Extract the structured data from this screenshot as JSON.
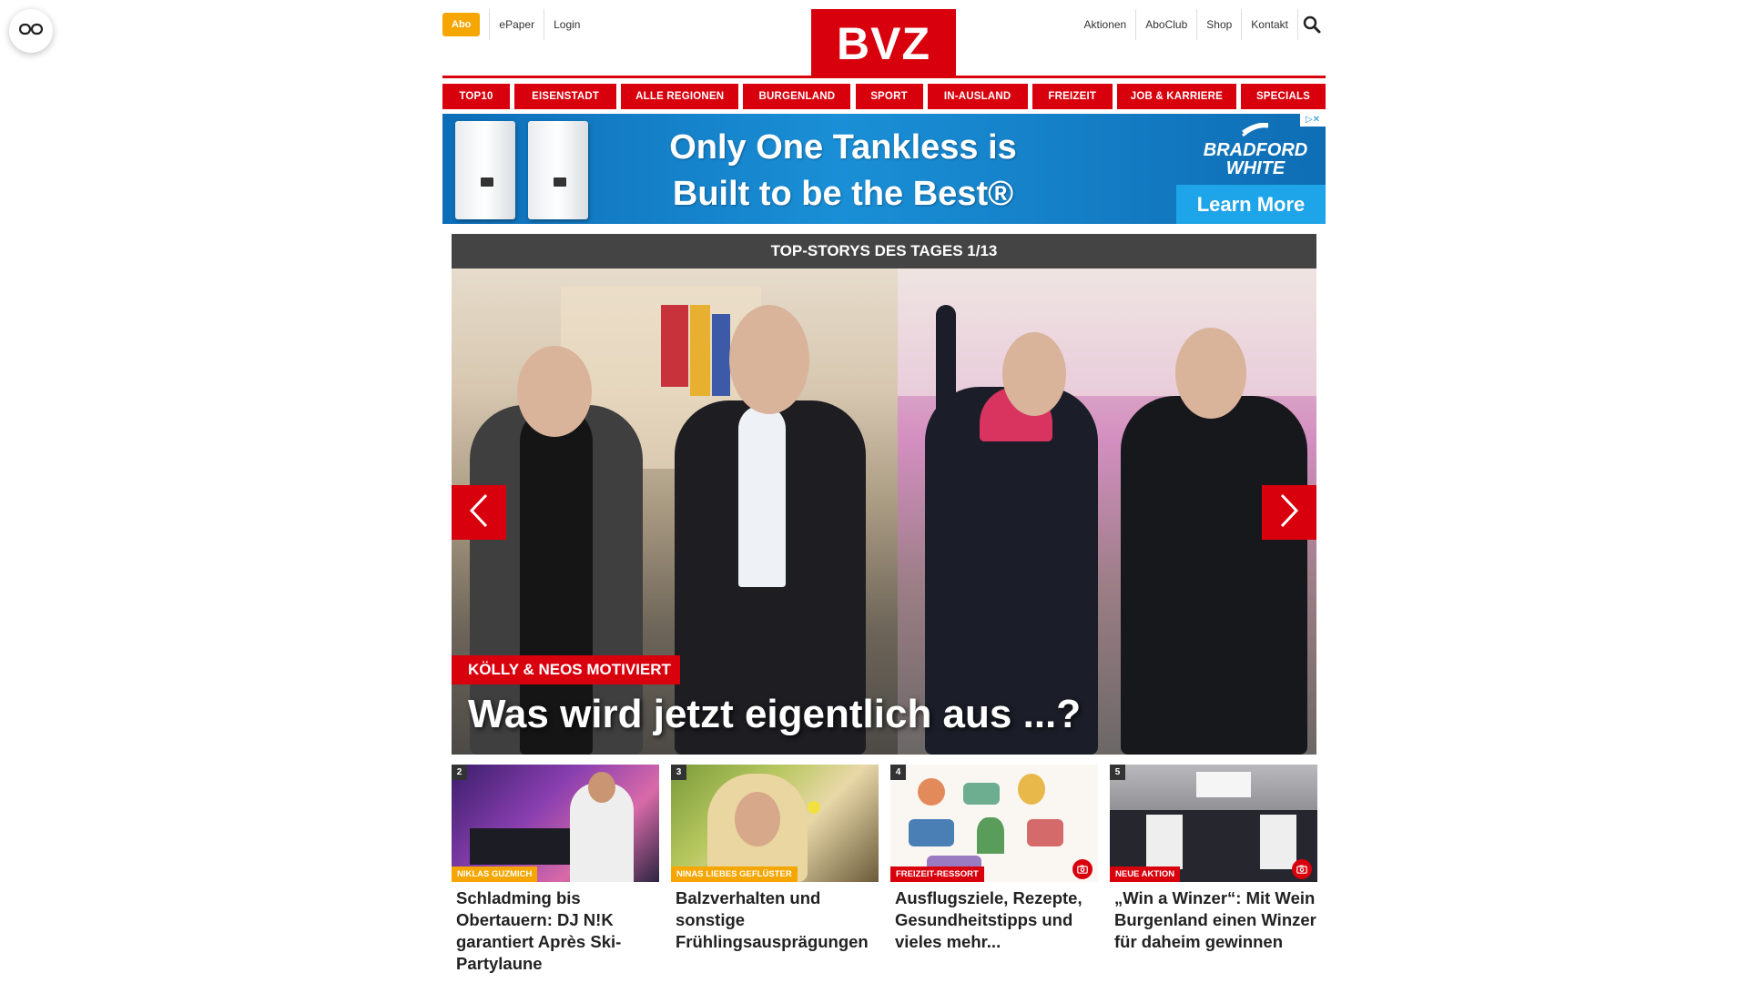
{
  "header": {
    "abo_label": "Abo",
    "epaper_label": "ePaper",
    "login_label": "Login",
    "logo_text": "BVZ",
    "right_links": [
      "Aktionen",
      "AboClub",
      "Shop",
      "Kontakt"
    ]
  },
  "nav": {
    "items": [
      "TOP10",
      "EISENSTADT",
      "ALLE REGIONEN",
      "BURGENLAND",
      "SPORT",
      "IN-AUSLAND",
      "FREIZEIT",
      "JOB & KARRIERE",
      "SPECIALS"
    ]
  },
  "ad": {
    "headline_line1": "Only One Tankless is",
    "headline_line2": "Built to be the Best®",
    "brand_line1": "BRADFORD",
    "brand_line2": "WHITE",
    "cta": "Learn More",
    "close_label": "▷✕"
  },
  "top_stories": {
    "header": "TOP-STORYS DES TAGES 1/13",
    "hero_tag": "KÖLLY & NEOS MOTIVIERT",
    "hero_title": "Was wird jetzt eigentlich aus ...?"
  },
  "articles": [
    {
      "num": "2",
      "tag": "NIKLAS GUZMICH",
      "tag_color": "#f5a600",
      "title": "Schladming bis Obertauern: DJ N!K garantiert Après Ski-Partylaune",
      "camera": false
    },
    {
      "num": "3",
      "tag": "NINAS LIEBES GEFLÜSTER",
      "tag_color": "#f5a600",
      "title": "Balzverhalten und sonstige Frühlingsausprägungen",
      "camera": false
    },
    {
      "num": "4",
      "tag": "FREIZEIT-RESSORT",
      "tag_color": "#d9000d",
      "title": "Ausflugsziele, Rezepte, Gesundheitstipps und vieles mehr...",
      "camera": true
    },
    {
      "num": "5",
      "tag": "NEUE AKTION",
      "tag_color": "#d9000d",
      "title": "„Win a Winzer“: Mit Wein Burgenland einen Winzer für daheim gewinnen",
      "camera": true
    }
  ],
  "colors": {
    "brand_red": "#d9000d",
    "abo_orange": "#f5a600",
    "stories_bar": "#444444"
  },
  "icons": {
    "accessibility": "glasses-icon",
    "search": "search-icon",
    "prev": "chevron-left-icon",
    "next": "chevron-right-icon",
    "camera": "camera-icon"
  }
}
